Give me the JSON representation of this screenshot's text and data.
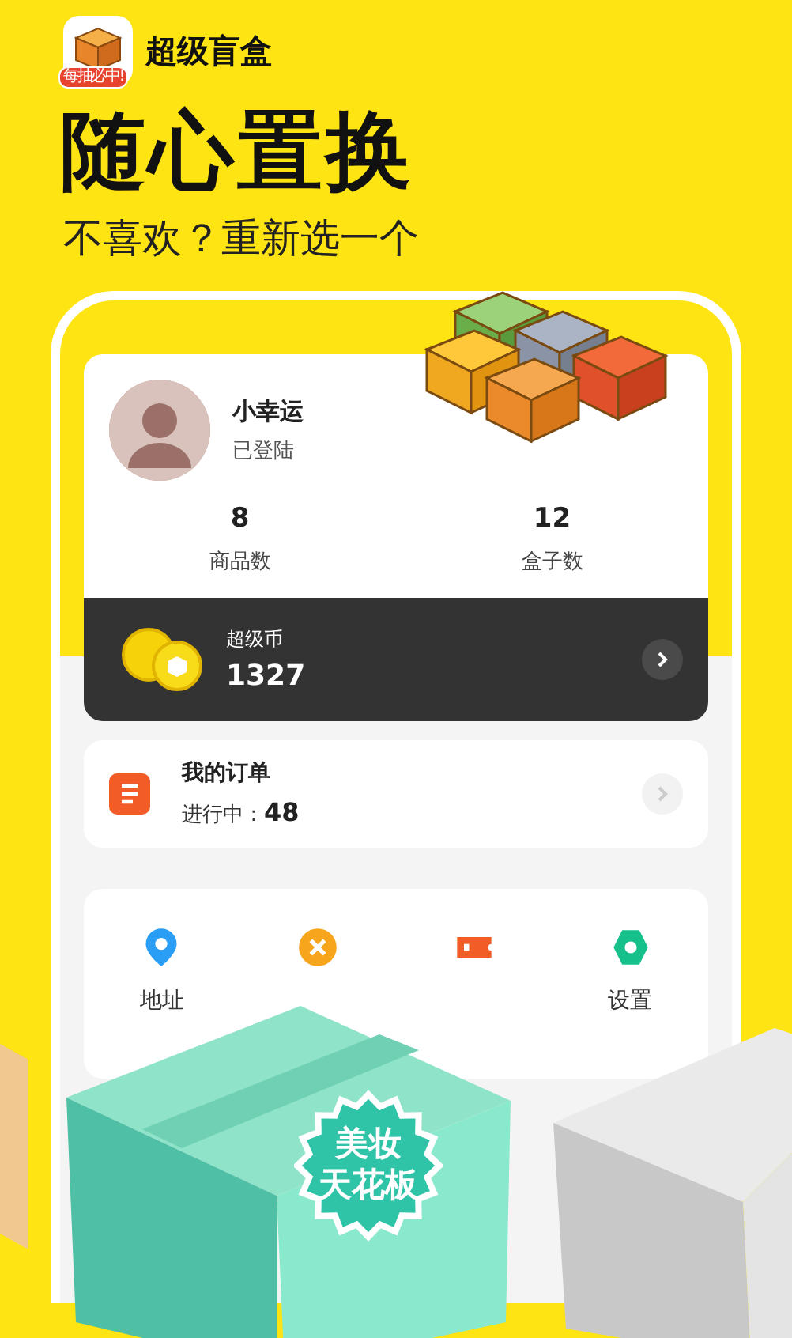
{
  "app": {
    "name": "超级盲盒",
    "logo_tag": "每抽必中!"
  },
  "headline": "随心置换",
  "subtitle": "不喜欢？重新选一个",
  "profile": {
    "name": "小幸运",
    "status": "已登陆"
  },
  "stats": [
    {
      "value": "8",
      "label": "商品数"
    },
    {
      "value": "12",
      "label": "盒子数"
    }
  ],
  "coins": {
    "label": "超级币",
    "amount": "1327"
  },
  "orders": {
    "title": "我的订单",
    "status_label": "进行中：",
    "count": "48"
  },
  "menu": [
    {
      "kind": "pin",
      "label": "地址"
    },
    {
      "kind": "coin"
    },
    {
      "kind": "ticket"
    },
    {
      "kind": "gear",
      "label": "设置"
    }
  ],
  "promo_badge": {
    "lines": [
      "美妆",
      "天花板"
    ]
  }
}
